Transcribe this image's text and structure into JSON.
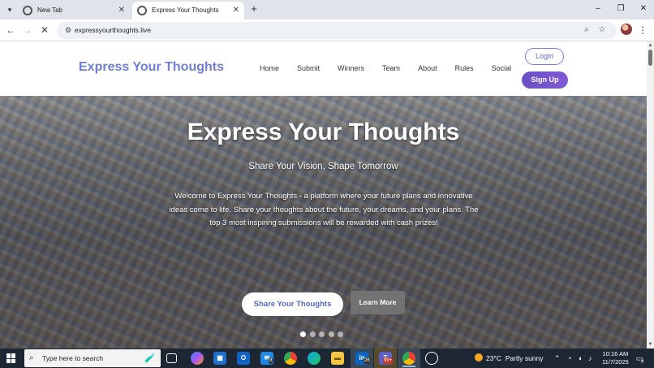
{
  "browser": {
    "tabs": [
      {
        "label": "New Tab",
        "active": false
      },
      {
        "label": "Express Your Thoughts",
        "active": true
      }
    ],
    "new_tab_symbol": "+",
    "url": "expressyourthoughts.live",
    "window_controls": [
      "–",
      "❐",
      "✕"
    ]
  },
  "site": {
    "logo": "Express Your Thoughts",
    "nav": [
      "Home",
      "Submit",
      "Winners",
      "Team",
      "About",
      "Rules",
      "Social"
    ],
    "login_label": "Login",
    "signup_label": "Sign Up"
  },
  "hero": {
    "title": "Express Your Thoughts",
    "subtitle": "Share Your Vision, Shape Tomorrow",
    "description": "Welcome to Express Your Thoughts - a platform where your future plans and innovative ideas come to life. Share your thoughts about the future, your dreams, and your plans. The top 3 most inspiring submissions will be rewarded with cash prizes!",
    "primary_button": "Share Your Thoughts",
    "secondary_button": "Learn More",
    "slides": 5,
    "active_slide": 1
  },
  "taskbar": {
    "search_placeholder": "Type here to search",
    "weather_temp": "23°C",
    "weather_text": "Partly sunny",
    "time": "10:16 AM",
    "date": "11/7/2025",
    "badges": {
      "mail": "8",
      "linkedin": "26",
      "teams": "99+",
      "notifications": "6"
    },
    "pinned_icons": [
      "task-view-icon",
      "copilot-icon",
      "store-icon",
      "outlook-icon",
      "mail-icon",
      "chrome-icon",
      "edge-icon",
      "file-explorer-icon",
      "linkedin-icon",
      "teams-icon",
      "chrome-active-icon",
      "chatgpt-icon"
    ]
  },
  "colors": {
    "brand": "#6f7fd9",
    "signup": "#6a4fc4",
    "taskbar": "#1c2733"
  }
}
